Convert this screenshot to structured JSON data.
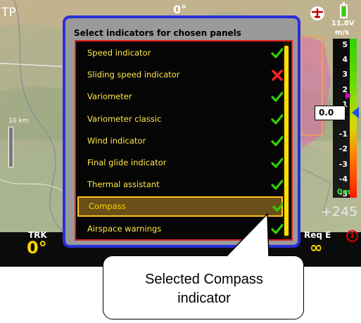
{
  "header": {
    "left_text": "TP",
    "heading": "0°",
    "voltage": "11.8V",
    "vario_unit": "m/s"
  },
  "vario": {
    "ticks": [
      "5",
      "4",
      "3",
      "2",
      "1",
      "",
      "-1",
      "-2",
      "-3",
      "-4",
      "-5"
    ],
    "current_value": "0.0",
    "zero_label": "0m"
  },
  "map": {
    "scale_label": "10 km",
    "altitude_text": "+245"
  },
  "bottom": {
    "trk_label": "TRK",
    "trk_value": "0°",
    "req_label": "Req E",
    "req_value": "∞",
    "alert_badge": "1"
  },
  "dialog": {
    "title": "Select indicators for chosen panels",
    "items": [
      {
        "label": "Speed indicator",
        "status": "enabled",
        "status_icon": "check-icon"
      },
      {
        "label": "Sliding speed indicator",
        "status": "disabled",
        "status_icon": "cross-icon"
      },
      {
        "label": "Variometer",
        "status": "enabled",
        "status_icon": "check-icon"
      },
      {
        "label": "Variometer classic",
        "status": "enabled",
        "status_icon": "check-icon"
      },
      {
        "label": "Wind indicator",
        "status": "enabled",
        "status_icon": "check-icon"
      },
      {
        "label": "Final glide indicator",
        "status": "enabled",
        "status_icon": "check-icon"
      },
      {
        "label": "Thermal assistant",
        "status": "enabled",
        "status_icon": "check-icon"
      },
      {
        "label": "Compass",
        "status": "enabled",
        "status_icon": "check-icon",
        "selected": true
      },
      {
        "label": "Airspace warnings",
        "status": "enabled",
        "status_icon": "check-icon"
      }
    ]
  },
  "callout": {
    "line1": "Selected Compass",
    "line2": "indicator"
  },
  "colors": {
    "dialog_border": "#2a2fd8",
    "list_border": "#e02020",
    "item_text": "#ffe84a",
    "selection_border": "#ffc21a",
    "check": "#2fd100",
    "cross": "#ff2020"
  }
}
